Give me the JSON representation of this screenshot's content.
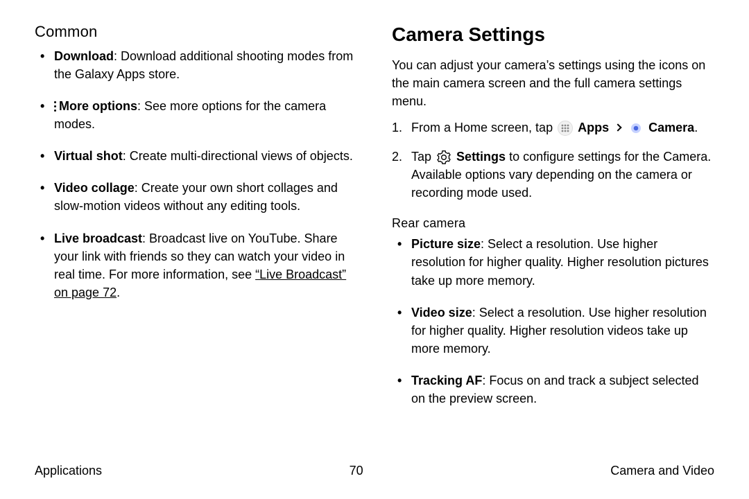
{
  "left": {
    "heading": "Common",
    "items": [
      {
        "label": "Download",
        "desc": ": Download additional shooting modes from the Galaxy Apps store."
      },
      {
        "label": "More options",
        "desc": ": See more options for the camera modes.",
        "icon": "more"
      },
      {
        "label": "Virtual shot",
        "desc": ": Create multi-directional views of objects."
      },
      {
        "label": "Video collage",
        "desc": ": Create your own short collages and slow-motion videos without any editing tools."
      },
      {
        "label": "Live broadcast",
        "desc": ": Broadcast live on YouTube. Share your link with friends so they can watch your video in real time. For more information, see ",
        "linktext": "“Live Broadcast” on page 72",
        "tail": "."
      }
    ]
  },
  "right": {
    "heading": "Camera Settings",
    "intro": "You can adjust your camera’s settings using the icons on the main camera screen and the full camera settings menu.",
    "step1_a": "From a Home screen, tap ",
    "step1_apps": "Apps",
    "step1_camera": "Camera",
    "step1_tail": ".",
    "step2_a": "Tap ",
    "step2_settings": "Settings",
    "step2_b": " to configure settings for the Camera. Available options vary depending on the camera or recording mode used.",
    "sub": "Rear camera",
    "rear": [
      {
        "label": "Picture size",
        "desc": ": Select a resolution. Use higher resolution for higher quality. Higher resolution pictures take up more memory."
      },
      {
        "label": "Video size",
        "desc": ": Select a resolution. Use higher resolution for higher quality. Higher resolution videos take up more memory."
      },
      {
        "label": "Tracking AF",
        "desc": ": Focus on and track a subject selected on the preview screen."
      }
    ]
  },
  "footer": {
    "left": "Applications",
    "center": "70",
    "right": "Camera and Video"
  }
}
